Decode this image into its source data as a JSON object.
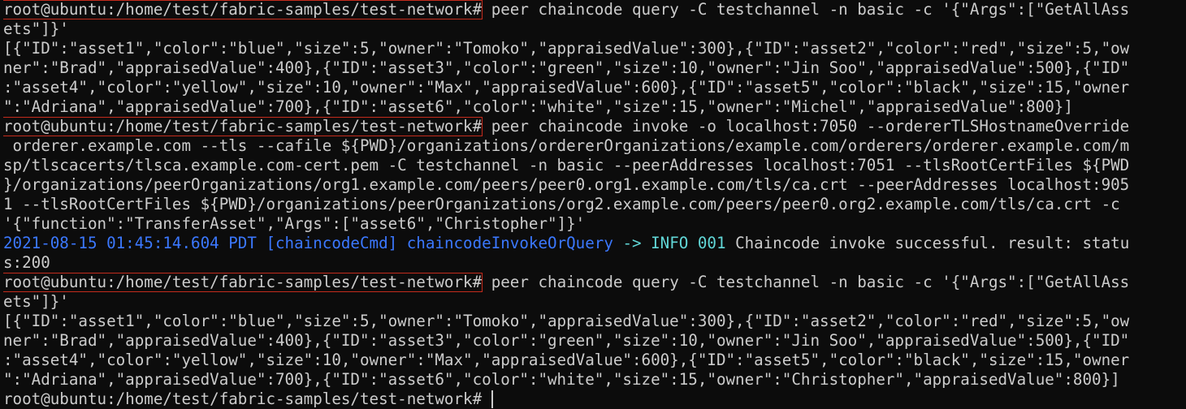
{
  "terminal": {
    "prompt": "root@ubuntu:/home/test/fabric-samples/test-network#",
    "lines": {
      "l01": " peer chaincode query -C testchannel -n basic -c '{\"Args\":[\"GetAllAss",
      "l02": "ets\"]}'",
      "l03": "[{\"ID\":\"asset1\",\"color\":\"blue\",\"size\":5,\"owner\":\"Tomoko\",\"appraisedValue\":300},{\"ID\":\"asset2\",\"color\":\"red\",\"size\":5,\"ow",
      "l04": "ner\":\"Brad\",\"appraisedValue\":400},{\"ID\":\"asset3\",\"color\":\"green\",\"size\":10,\"owner\":\"Jin Soo\",\"appraisedValue\":500},{\"ID\"",
      "l05": ":\"asset4\",\"color\":\"yellow\",\"size\":10,\"owner\":\"Max\",\"appraisedValue\":600},{\"ID\":\"asset5\",\"color\":\"black\",\"size\":15,\"owner",
      "l06": "\":\"Adriana\",\"appraisedValue\":700},{\"ID\":\"asset6\",\"color\":\"white\",\"size\":15,\"owner\":\"Michel\",\"appraisedValue\":800}]",
      "l07": " peer chaincode invoke -o localhost:7050 --ordererTLSHostnameOverride",
      "l08": " orderer.example.com --tls --cafile ${PWD}/organizations/ordererOrganizations/example.com/orderers/orderer.example.com/m",
      "l09": "sp/tlscacerts/tlsca.example.com-cert.pem -C testchannel -n basic --peerAddresses localhost:7051 --tlsRootCertFiles ${PWD",
      "l10": "}/organizations/peerOrganizations/org1.example.com/peers/peer0.org1.example.com/tls/ca.crt --peerAddresses localhost:905",
      "l11": "1 --tlsRootCertFiles ${PWD}/organizations/peerOrganizations/org2.example.com/peers/peer0.org2.example.com/tls/ca.crt -c",
      "l12": "'{\"function\":\"TransferAsset\",\"Args\":[\"asset6\",\"Christopher\"]}'",
      "l13_time": "2021-08-15 01:45:14.604 PDT",
      "l13_tag": " [chaincodeCmd]",
      "l13_func": " chaincodeInvokeOrQuery",
      "l13_arrow": " -> INFO 001",
      "l13_msg": " Chaincode invoke successful. result: statu",
      "l14": "s:200",
      "l15": " peer chaincode query -C testchannel -n basic -c '{\"Args\":[\"GetAllAss",
      "l16": "ets\"]}'",
      "l17": "[{\"ID\":\"asset1\",\"color\":\"blue\",\"size\":5,\"owner\":\"Tomoko\",\"appraisedValue\":300},{\"ID\":\"asset2\",\"color\":\"red\",\"size\":5,\"ow",
      "l18": "ner\":\"Brad\",\"appraisedValue\":400},{\"ID\":\"asset3\",\"color\":\"green\",\"size\":10,\"owner\":\"Jin Soo\",\"appraisedValue\":500},{\"ID\"",
      "l19": ":\"asset4\",\"color\":\"yellow\",\"size\":10,\"owner\":\"Max\",\"appraisedValue\":600},{\"ID\":\"asset5\",\"color\":\"black\",\"size\":15,\"owner",
      "l20": "\":\"Adriana\",\"appraisedValue\":700},{\"ID\":\"asset6\",\"color\":\"white\",\"size\":15,\"owner\":\"Christopher\",\"appraisedValue\":800}]",
      "l21": " "
    },
    "colors": {
      "background": "#0c0c0c",
      "foreground": "#cccccc",
      "highlight_box": "#c42b1c",
      "log_blue": "#3b78ff",
      "log_cyan": "#61d6d6"
    }
  }
}
